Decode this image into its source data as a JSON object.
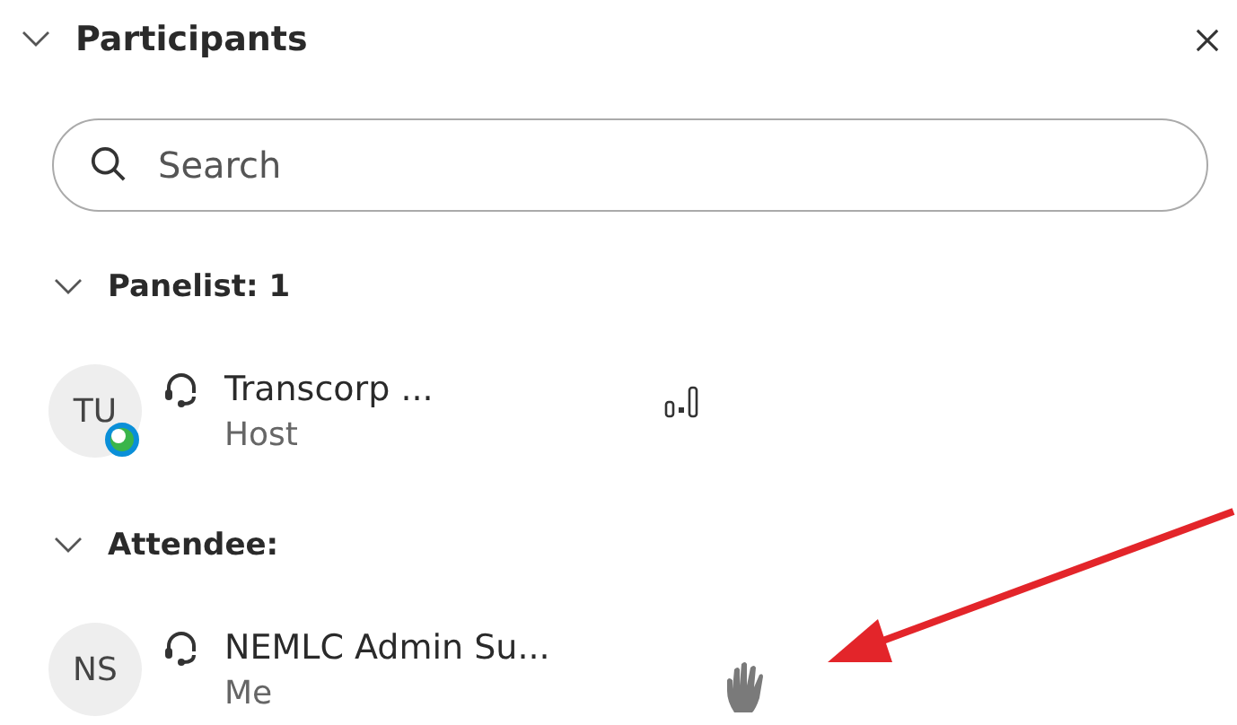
{
  "panel": {
    "title": "Participants",
    "expanded": true
  },
  "search": {
    "placeholder": "Search"
  },
  "sections": [
    {
      "title": "Panelist: 1",
      "expanded": true,
      "people": [
        {
          "initials": "TU",
          "name": "Transcorp ...",
          "role": "Host",
          "app_badge": true,
          "audio_meter": true,
          "hand_raised": false
        }
      ]
    },
    {
      "title": "Attendee:",
      "expanded": true,
      "people": [
        {
          "initials": "NS",
          "name": "NEMLC Admin Su...",
          "role": "Me",
          "app_badge": false,
          "audio_meter": false,
          "hand_raised": true
        }
      ]
    }
  ],
  "annotation": {
    "kind": "arrow"
  }
}
